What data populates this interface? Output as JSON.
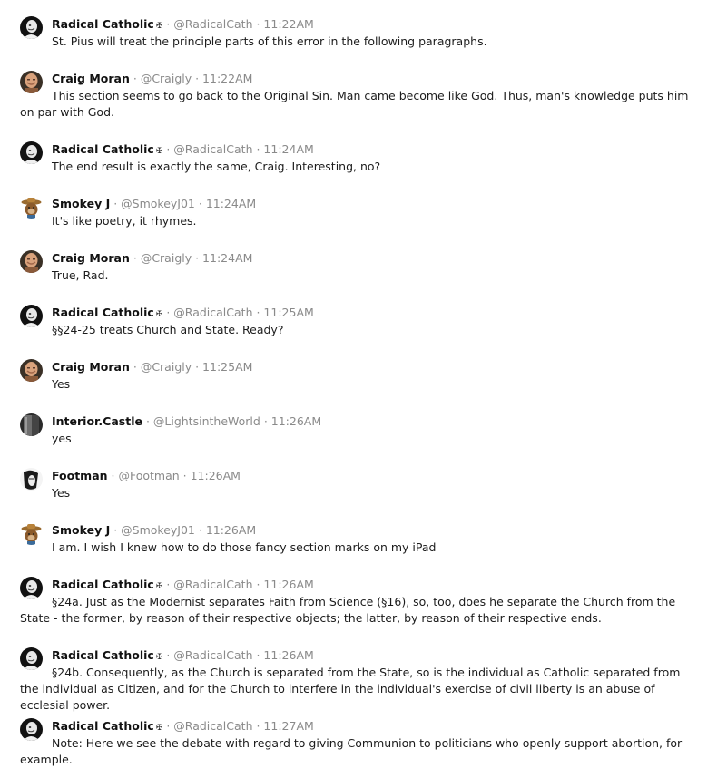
{
  "messages": [
    {
      "avatar": "radical-catholic-avatar",
      "name": "Radical Catholic",
      "badge": "✠",
      "handle": "@RadicalCath",
      "time": "11:22AM",
      "text": "St. Pius will treat the principle parts of this error in the following paragraphs."
    },
    {
      "avatar": "craig-moran-avatar",
      "name": "Craig Moran",
      "badge": "",
      "handle": "@Craigly",
      "time": "11:22AM",
      "text": "This section seems to go back to the Original Sin. Man came become like God. Thus, man's knowledge puts him on par with God."
    },
    {
      "avatar": "radical-catholic-avatar",
      "name": "Radical Catholic",
      "badge": "✠",
      "handle": "@RadicalCath",
      "time": "11:24AM",
      "text": "The end result is exactly the same, Craig. Interesting, no?"
    },
    {
      "avatar": "smokey-j-avatar",
      "name": "Smokey J",
      "badge": "",
      "handle": "@SmokeyJ01",
      "time": "11:24AM",
      "text": "It's like poetry, it rhymes."
    },
    {
      "avatar": "craig-moran-avatar",
      "name": "Craig Moran",
      "badge": "",
      "handle": "@Craigly",
      "time": "11:24AM",
      "text": "True, Rad."
    },
    {
      "avatar": "radical-catholic-avatar",
      "name": "Radical Catholic",
      "badge": "✠",
      "handle": "@RadicalCath",
      "time": "11:25AM",
      "text": "§§24-25 treats Church and State. Ready?"
    },
    {
      "avatar": "craig-moran-avatar",
      "name": "Craig Moran",
      "badge": "",
      "handle": "@Craigly",
      "time": "11:25AM",
      "text": "Yes"
    },
    {
      "avatar": "interior-castle-avatar",
      "name": "Interior.Castle",
      "badge": "",
      "handle": "@LightsintheWorld",
      "time": "11:26AM",
      "text": "yes"
    },
    {
      "avatar": "footman-avatar",
      "name": "Footman",
      "badge": "",
      "handle": "@Footman",
      "time": "11:26AM",
      "text": "Yes"
    },
    {
      "avatar": "smokey-j-avatar",
      "name": "Smokey J",
      "badge": "",
      "handle": "@SmokeyJ01",
      "time": "11:26AM",
      "text": "I am. I wish I knew how to do those fancy section marks on my iPad"
    },
    {
      "avatar": "radical-catholic-avatar",
      "name": "Radical Catholic",
      "badge": "✠",
      "handle": "@RadicalCath",
      "time": "11:26AM",
      "text": "§24a. Just as the Modernist separates Faith from Science (§16), so, too, does he separate the Church from the State - the former, by reason of their respective objects; the latter, by reason of their respective ends."
    },
    {
      "avatar": "radical-catholic-avatar",
      "name": "Radical Catholic",
      "badge": "✠",
      "handle": "@RadicalCath",
      "time": "11:26AM",
      "text": "§24b. Consequently, as the Church is separated from the State, so is the individual as Catholic separated from the individual as Citizen, and for the Church to interfere in the individual's exercise of civil liberty is an abuse of ecclesial power."
    },
    {
      "avatar": "radical-catholic-avatar",
      "name": "Radical Catholic",
      "badge": "✠",
      "handle": "@RadicalCath",
      "time": "11:27AM",
      "text": "Note: Here we see the debate with regard to giving Communion to politicians who openly support abortion, for example."
    }
  ]
}
